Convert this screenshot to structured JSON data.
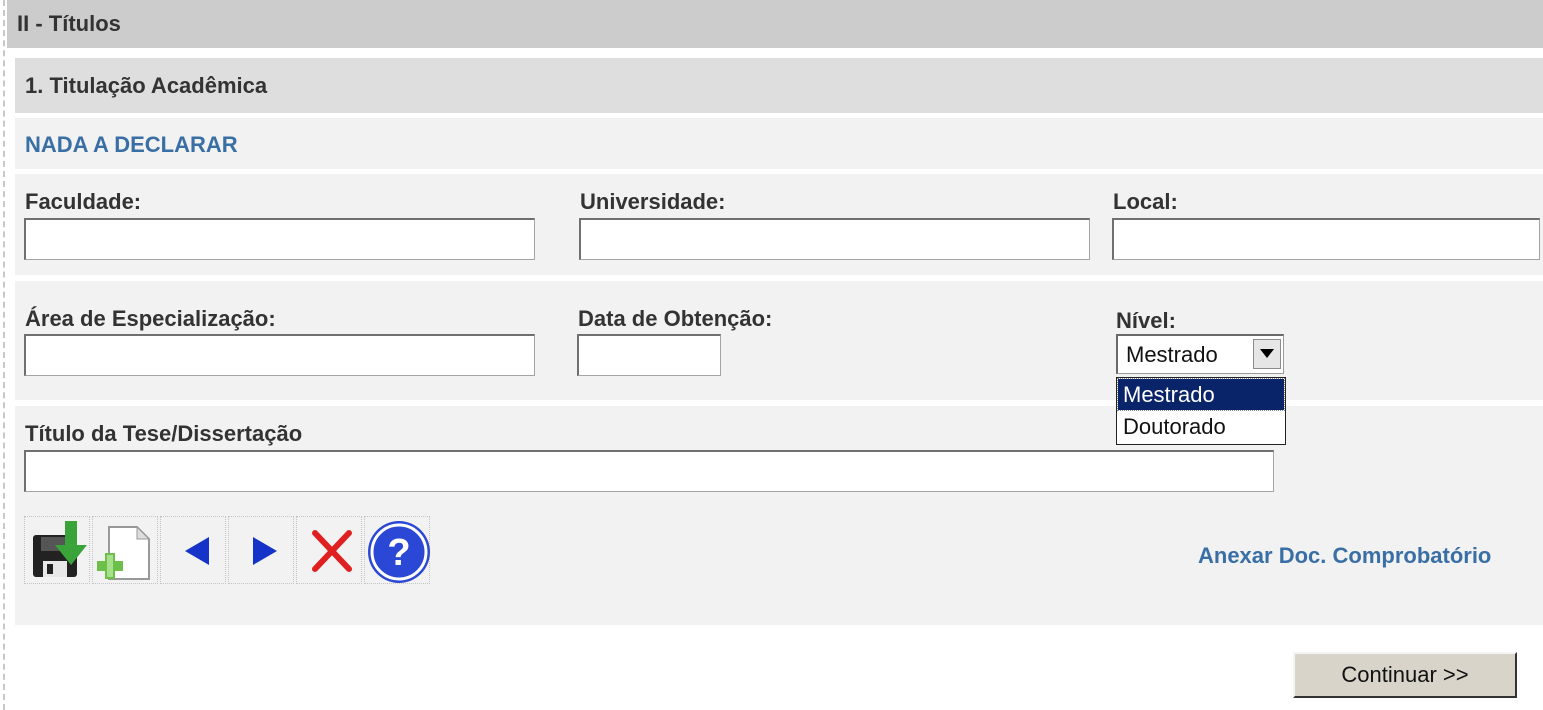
{
  "section": {
    "title": "II - Títulos"
  },
  "subsection": {
    "title": "1. Titulação Acadêmica"
  },
  "nada_a_declarar": "NADA A DECLARAR",
  "fields": {
    "faculdade": {
      "label": "Faculdade:",
      "value": ""
    },
    "universidade": {
      "label": "Universidade:",
      "value": ""
    },
    "local": {
      "label": "Local:",
      "value": ""
    },
    "area": {
      "label": "Área de Especialização:",
      "value": ""
    },
    "data": {
      "label": "Data de Obtenção:",
      "value": ""
    },
    "nivel": {
      "label": "Nível:",
      "selected": "Mestrado",
      "options": [
        "Mestrado",
        "Doutorado"
      ],
      "highlighted_option": "Mestrado"
    },
    "titulo": {
      "label": "Título da Tese/Dissertação",
      "value": ""
    }
  },
  "toolbar": {
    "buttons": [
      "save-icon",
      "new-document-icon",
      "previous-icon",
      "next-icon",
      "delete-icon",
      "help-icon"
    ]
  },
  "anexar_link": "Anexar Doc. Comprobatório",
  "continue_label": "Continuar >>",
  "colors": {
    "link": "#3a6fa6",
    "selected_option_bg": "#0a246a",
    "header_bg": "#cccccc",
    "subheader_bg": "#dedede",
    "panel_bg": "#f2f2f2"
  }
}
